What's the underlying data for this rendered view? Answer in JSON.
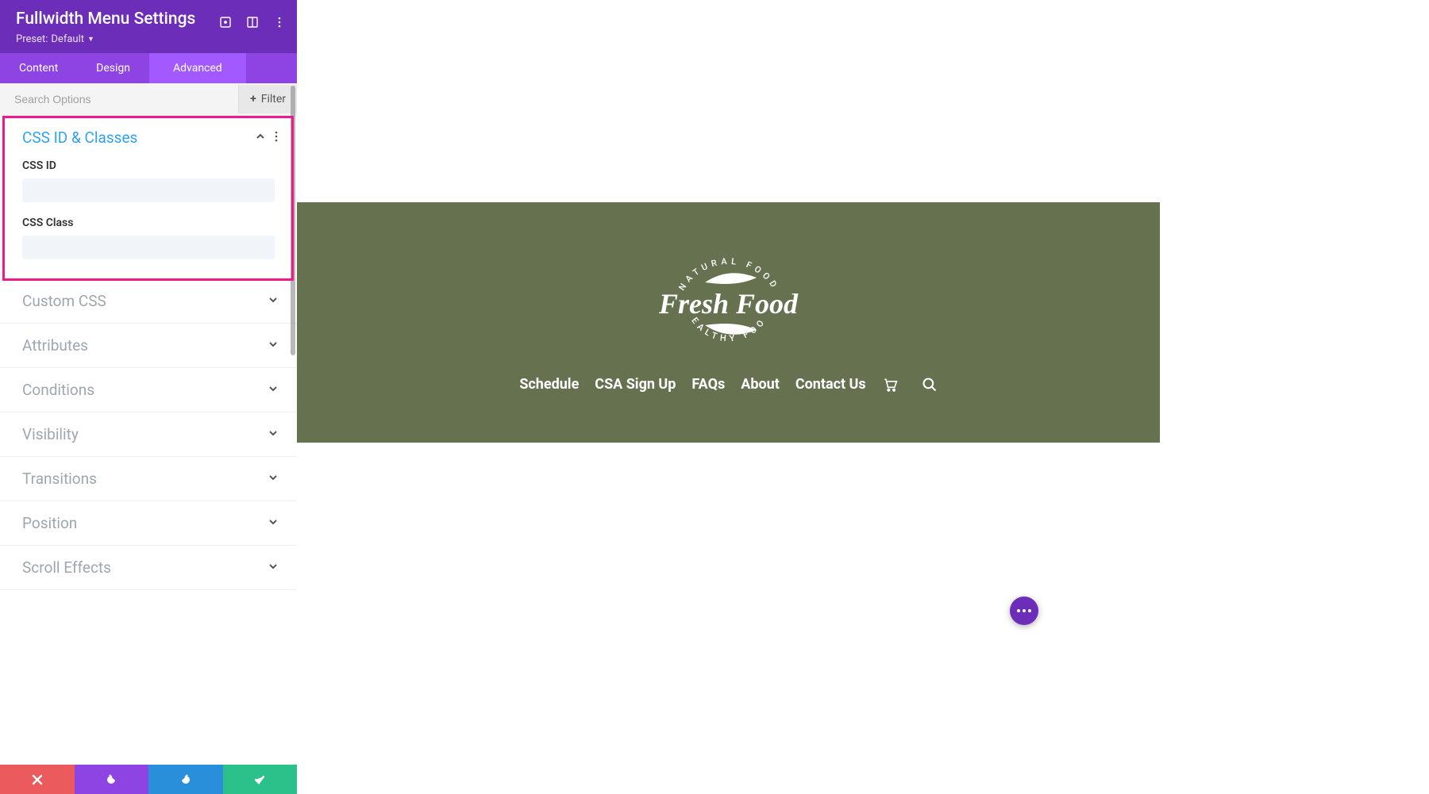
{
  "header": {
    "title": "Fullwidth Menu Settings",
    "preset_prefix": "Preset:",
    "preset_value": "Default"
  },
  "tabs": [
    {
      "label": "Content",
      "active": false
    },
    {
      "label": "Design",
      "active": false
    },
    {
      "label": "Advanced",
      "active": true
    }
  ],
  "search": {
    "placeholder": "Search Options",
    "filter_label": "Filter"
  },
  "sections": {
    "css_id_classes": {
      "title": "CSS ID & Classes",
      "open": true,
      "fields": {
        "css_id_label": "CSS ID",
        "css_id_value": "",
        "css_class_label": "CSS Class",
        "css_class_value": ""
      }
    },
    "custom_css": {
      "title": "Custom CSS"
    },
    "attributes": {
      "title": "Attributes"
    },
    "conditions": {
      "title": "Conditions"
    },
    "visibility": {
      "title": "Visibility"
    },
    "transitions": {
      "title": "Transitions"
    },
    "position": {
      "title": "Position"
    },
    "scroll_effects": {
      "title": "Scroll Effects"
    }
  },
  "preview": {
    "logo": {
      "arc_top": "NATURAL FOOD",
      "main": "Fresh Food",
      "arc_bottom": "HEALTHY FOOD"
    },
    "nav": [
      {
        "label": "Schedule"
      },
      {
        "label": "CSA Sign Up"
      },
      {
        "label": "FAQs"
      },
      {
        "label": "About"
      },
      {
        "label": "Contact Us"
      }
    ]
  },
  "colors": {
    "panel_header": "#6C2EB9",
    "tab_bg": "#8E44E3",
    "tab_active": "#A259FF",
    "hero_bg": "#667150",
    "highlight": "#EC1A8C",
    "link_blue": "#2EA3F2"
  }
}
